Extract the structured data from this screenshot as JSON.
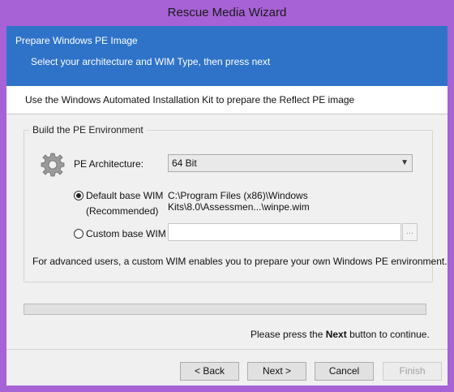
{
  "window": {
    "title": "Rescue Media Wizard"
  },
  "header": {
    "title": "Prepare Windows PE Image",
    "subtitle": "Select your architecture and WIM Type, then press next"
  },
  "info": {
    "text": "Use the Windows Automated Installation Kit to prepare the Reflect PE image"
  },
  "group": {
    "legend": "Build the PE Environment",
    "architecture_label": "PE Architecture:",
    "architecture_value": "64 Bit",
    "default_wim_label": "Default base WIM",
    "default_wim_sub": "(Recommended)",
    "default_wim_path": "C:\\Program Files (x86)\\Windows Kits\\8.0\\Assessmen...\\winpe.wim",
    "custom_wim_label": "Custom base WIM",
    "custom_wim_value": "",
    "browse_label": "...",
    "note": "For advanced users, a custom WIM enables you to prepare your own Windows PE environment."
  },
  "footer": {
    "continue_prefix": "Please press the ",
    "continue_bold": "Next",
    "continue_suffix": " button to continue.",
    "back": "< Back",
    "next": "Next >",
    "cancel": "Cancel",
    "finish": "Finish"
  },
  "colors": {
    "accent": "#2f73c9",
    "window_frame": "#a762d6"
  },
  "icons": {
    "architecture": "gear-icon",
    "dropdown": "chevron-down-icon"
  }
}
